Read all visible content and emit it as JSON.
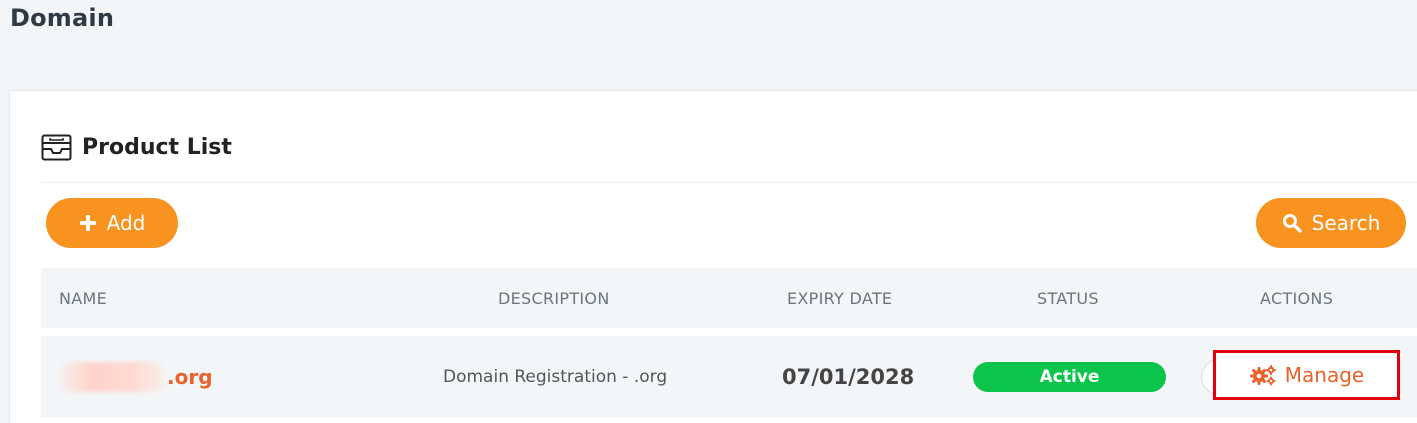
{
  "page": {
    "title": "Domain"
  },
  "card": {
    "title": "Product List",
    "icon": "inbox-tray-icon",
    "buttons": {
      "add": {
        "label": "Add",
        "icon": "plus-icon"
      },
      "search": {
        "label": "Search",
        "icon": "search-icon"
      }
    }
  },
  "table": {
    "columns": [
      "NAME",
      "DESCRIPTION",
      "EXPIRY DATE",
      "STATUS",
      "ACTIONS"
    ],
    "rows": [
      {
        "name_suffix": ".org",
        "description": "Domain Registration - .org",
        "expiry_date": "07/01/2028",
        "status": "Active",
        "action_label": "Manage",
        "action_icon": "gears-icon"
      }
    ]
  },
  "colors": {
    "accent": "#f7931e",
    "link": "#e8632b",
    "status_active": "#0cc44c",
    "highlight_border": "#e0000f"
  }
}
